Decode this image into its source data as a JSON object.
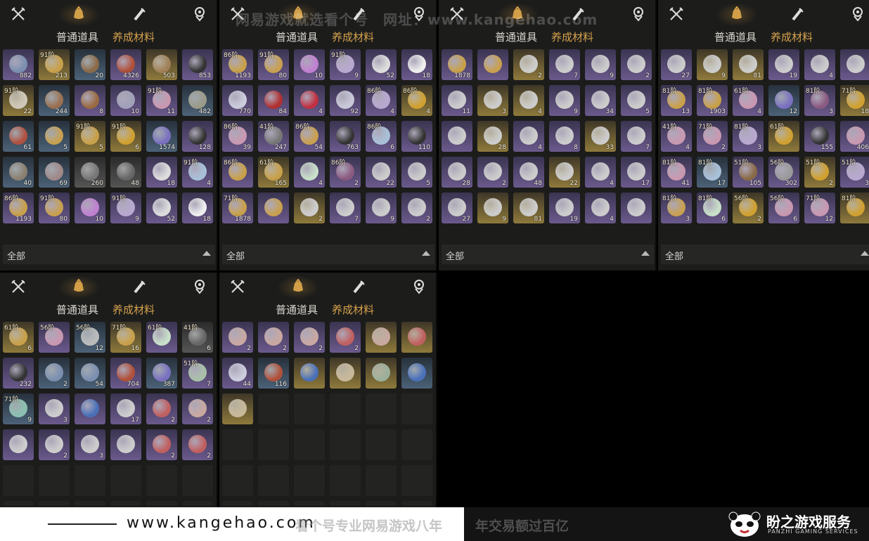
{
  "tabs": {
    "weapon_icon": "crossed-swords-icon",
    "bag_icon": "coin-bag-icon",
    "scroll_icon": "scroll-brush-icon",
    "gem_icon": "gem-badge-icon"
  },
  "subtabs": {
    "common": "普通道具",
    "growth": "养成材料"
  },
  "filter": {
    "label": "全部"
  },
  "colors": {
    "accent": "#d5a24c",
    "purple": "#6b5a8d",
    "gold": "#8f7a3c",
    "blue": "#4c6278"
  },
  "watermark_top": "网易游戏就选看个号　网址：www.kangehao.com",
  "banner": {
    "site": "www.kangehao.com",
    "slogan": "看个号专业网易游戏八年",
    "slogan2": "年交易额过百亿",
    "brand": "盼之游戏服务",
    "brand_sub": "PANZHI GAMING SERVICES"
  },
  "panels": [
    {
      "items": [
        {
          "q": "purple",
          "lvl": "",
          "qty": "882",
          "c": "#7b8fb0"
        },
        {
          "q": "gold",
          "lvl": "91阶",
          "qty": "213",
          "c": "#c8a04a"
        },
        {
          "q": "blue",
          "lvl": "",
          "qty": "20",
          "c": "#8a6a48"
        },
        {
          "q": "purple",
          "lvl": "",
          "qty": "4326",
          "c": "#b0503a"
        },
        {
          "q": "gold",
          "lvl": "",
          "qty": "503",
          "c": "#a08058"
        },
        {
          "q": "purple",
          "lvl": "",
          "qty": "853",
          "c": "#333"
        },
        {
          "q": "gold",
          "lvl": "91阶",
          "qty": "22",
          "c": "#cfc8b8"
        },
        {
          "q": "blue",
          "lvl": "",
          "qty": "244",
          "c": "#9a7050"
        },
        {
          "q": "purple",
          "lvl": "",
          "qty": "8",
          "c": "#9a6a40"
        },
        {
          "q": "purple",
          "lvl": "",
          "qty": "10",
          "c": "#a0a0b8"
        },
        {
          "q": "purple",
          "lvl": "91阶",
          "qty": "11",
          "c": "#c898b0"
        },
        {
          "q": "blue",
          "lvl": "",
          "qty": "482",
          "c": "#9a9a88"
        },
        {
          "q": "blue",
          "lvl": "",
          "qty": "61",
          "c": "#b05040"
        },
        {
          "q": "blue",
          "lvl": "",
          "qty": "5",
          "c": "#c8a050"
        },
        {
          "q": "gold",
          "lvl": "91阶",
          "qty": "5",
          "c": "#c8a04a"
        },
        {
          "q": "gold",
          "lvl": "91阶",
          "qty": "6",
          "c": "#d0a030"
        },
        {
          "q": "blue",
          "lvl": "",
          "qty": "1574",
          "c": "#7a70c0"
        },
        {
          "q": "purple",
          "lvl": "",
          "qty": "128",
          "c": "#333"
        },
        {
          "q": "blue",
          "lvl": "",
          "qty": "40",
          "c": "#8a8070"
        },
        {
          "q": "blue",
          "lvl": "",
          "qty": "69",
          "c": "#a08888"
        },
        {
          "q": "grey",
          "lvl": "",
          "qty": "260",
          "c": "#777"
        },
        {
          "q": "grey",
          "lvl": "",
          "qty": "48",
          "c": "#666"
        },
        {
          "q": "purple",
          "lvl": "",
          "qty": "18",
          "c": "#ddd"
        },
        {
          "q": "purple",
          "lvl": "91阶",
          "qty": "4",
          "c": "#a8c0d8"
        },
        {
          "q": "purple",
          "lvl": "86阶",
          "qty": "1193",
          "c": "#c8a04a"
        },
        {
          "q": "purple",
          "lvl": "91阶",
          "qty": "80",
          "c": "#c8a050"
        },
        {
          "q": "purple",
          "lvl": "",
          "qty": "10",
          "c": "#c080d0"
        },
        {
          "q": "purple",
          "lvl": "91阶",
          "qty": "9",
          "c": "#b8a8d0"
        },
        {
          "q": "purple",
          "lvl": "",
          "qty": "52",
          "c": "#ddd"
        },
        {
          "q": "purple",
          "lvl": "",
          "qty": "18",
          "c": "#eee"
        }
      ]
    },
    {
      "items": [
        {
          "q": "purple",
          "lvl": "86阶",
          "qty": "1193",
          "c": "#c8a04a"
        },
        {
          "q": "purple",
          "lvl": "91阶",
          "qty": "80",
          "c": "#c8a050"
        },
        {
          "q": "purple",
          "lvl": "",
          "qty": "10",
          "c": "#c080d0"
        },
        {
          "q": "purple",
          "lvl": "91阶",
          "qty": "9",
          "c": "#b8a8d0"
        },
        {
          "q": "purple",
          "lvl": "",
          "qty": "52",
          "c": "#ddd"
        },
        {
          "q": "purple",
          "lvl": "",
          "qty": "18",
          "c": "#eee"
        },
        {
          "q": "purple",
          "lvl": "",
          "qty": "770",
          "c": "#ccd"
        },
        {
          "q": "purple",
          "lvl": "",
          "qty": "84",
          "c": "#b03030"
        },
        {
          "q": "purple",
          "lvl": "",
          "qty": "4",
          "c": "#c03040"
        },
        {
          "q": "purple",
          "lvl": "",
          "qty": "92",
          "c": "#c8c8d8"
        },
        {
          "q": "purple",
          "lvl": "86阶",
          "qty": "4",
          "c": "#b8a8d0"
        },
        {
          "q": "gold",
          "lvl": "86阶",
          "qty": "4",
          "c": "#d0a030"
        },
        {
          "q": "purple",
          "lvl": "86阶",
          "qty": "39",
          "c": "#c898b0"
        },
        {
          "q": "purple",
          "lvl": "41阶",
          "qty": "247",
          "c": "#777"
        },
        {
          "q": "purple",
          "lvl": "86阶",
          "qty": "54",
          "c": "#c8a050"
        },
        {
          "q": "purple",
          "lvl": "",
          "qty": "763",
          "c": "#333"
        },
        {
          "q": "purple",
          "lvl": "86阶",
          "qty": "6",
          "c": "#a8c0d8"
        },
        {
          "q": "purple",
          "lvl": "",
          "qty": "110",
          "c": "#333"
        },
        {
          "q": "purple",
          "lvl": "86阶",
          "qty": "",
          "c": "#c8a04a"
        },
        {
          "q": "gold",
          "lvl": "61阶",
          "qty": "165",
          "c": "#c8a04a"
        },
        {
          "q": "purple",
          "lvl": "",
          "qty": "4",
          "c": "#c8e0c8"
        },
        {
          "q": "purple",
          "lvl": "86阶",
          "qty": "2",
          "c": "#8a5a80"
        },
        {
          "q": "purple",
          "lvl": "",
          "qty": "22",
          "c": "#ccc"
        },
        {
          "q": "purple",
          "lvl": "",
          "qty": "5",
          "c": "#ccc"
        },
        {
          "q": "purple",
          "lvl": "71阶",
          "qty": "1878",
          "c": "#c8a04a"
        },
        {
          "q": "purple",
          "lvl": "",
          "qty": "",
          "c": "#c8a050"
        },
        {
          "q": "gold",
          "lvl": "",
          "qty": "2",
          "c": "#ccc"
        },
        {
          "q": "purple",
          "lvl": "",
          "qty": "7",
          "c": "#ccc"
        },
        {
          "q": "purple",
          "lvl": "",
          "qty": "9",
          "c": "#ccc"
        },
        {
          "q": "purple",
          "lvl": "",
          "qty": "2",
          "c": "#ccc"
        }
      ]
    },
    {
      "items": [
        {
          "q": "purple",
          "lvl": "",
          "qty": "1878",
          "c": "#c8a04a"
        },
        {
          "q": "purple",
          "lvl": "",
          "qty": "",
          "c": "#c8a050"
        },
        {
          "q": "gold",
          "lvl": "",
          "qty": "2",
          "c": "#ccc"
        },
        {
          "q": "purple",
          "lvl": "",
          "qty": "7",
          "c": "#ccc"
        },
        {
          "q": "purple",
          "lvl": "",
          "qty": "9",
          "c": "#ccc"
        },
        {
          "q": "purple",
          "lvl": "",
          "qty": "2",
          "c": "#ccc"
        },
        {
          "q": "purple",
          "lvl": "",
          "qty": "11",
          "c": "#ccc"
        },
        {
          "q": "gold",
          "lvl": "",
          "qty": "3",
          "c": "#ccc"
        },
        {
          "q": "gold",
          "lvl": "",
          "qty": "4",
          "c": "#ccc"
        },
        {
          "q": "purple",
          "lvl": "",
          "qty": "9",
          "c": "#ccc"
        },
        {
          "q": "purple",
          "lvl": "",
          "qty": "34",
          "c": "#ccc"
        },
        {
          "q": "purple",
          "lvl": "",
          "qty": "5",
          "c": "#ccc"
        },
        {
          "q": "purple",
          "lvl": "",
          "qty": "",
          "c": "#ccc"
        },
        {
          "q": "gold",
          "lvl": "",
          "qty": "28",
          "c": "#ccc"
        },
        {
          "q": "purple",
          "lvl": "",
          "qty": "4",
          "c": "#ccc"
        },
        {
          "q": "purple",
          "lvl": "",
          "qty": "8",
          "c": "#ccc"
        },
        {
          "q": "gold",
          "lvl": "",
          "qty": "33",
          "c": "#ccc"
        },
        {
          "q": "purple",
          "lvl": "",
          "qty": "7",
          "c": "#ccc"
        },
        {
          "q": "purple",
          "lvl": "",
          "qty": "28",
          "c": "#ccc"
        },
        {
          "q": "purple",
          "lvl": "",
          "qty": "2",
          "c": "#ccc"
        },
        {
          "q": "purple",
          "lvl": "",
          "qty": "48",
          "c": "#ccc"
        },
        {
          "q": "gold",
          "lvl": "",
          "qty": "22",
          "c": "#ccc"
        },
        {
          "q": "purple",
          "lvl": "",
          "qty": "4",
          "c": "#ccc"
        },
        {
          "q": "purple",
          "lvl": "",
          "qty": "17",
          "c": "#ccc"
        },
        {
          "q": "purple",
          "lvl": "",
          "qty": "27",
          "c": "#ccc"
        },
        {
          "q": "gold",
          "lvl": "",
          "qty": "9",
          "c": "#ccc"
        },
        {
          "q": "gold",
          "lvl": "",
          "qty": "81",
          "c": "#ccc"
        },
        {
          "q": "purple",
          "lvl": "",
          "qty": "19",
          "c": "#ccc"
        },
        {
          "q": "purple",
          "lvl": "",
          "qty": "4",
          "c": "#ccc"
        },
        {
          "q": "purple",
          "lvl": "",
          "qty": "",
          "c": "#ccc"
        }
      ]
    },
    {
      "items": [
        {
          "q": "purple",
          "lvl": "",
          "qty": "27",
          "c": "#ccc"
        },
        {
          "q": "gold",
          "lvl": "",
          "qty": "9",
          "c": "#ccc"
        },
        {
          "q": "gold",
          "lvl": "",
          "qty": "81",
          "c": "#ccc"
        },
        {
          "q": "purple",
          "lvl": "",
          "qty": "19",
          "c": "#ccc"
        },
        {
          "q": "purple",
          "lvl": "",
          "qty": "4",
          "c": "#ccc"
        },
        {
          "q": "purple",
          "lvl": "",
          "qty": "",
          "c": "#ccc"
        },
        {
          "q": "purple",
          "lvl": "81阶",
          "qty": "13",
          "c": "#c8a04a"
        },
        {
          "q": "purple",
          "lvl": "81阶",
          "qty": "1903",
          "c": "#c8a04a"
        },
        {
          "q": "purple",
          "lvl": "61阶",
          "qty": "4",
          "c": "#c898b0"
        },
        {
          "q": "blue",
          "lvl": "",
          "qty": "12",
          "c": "#7a70c0"
        },
        {
          "q": "purple",
          "lvl": "81阶",
          "qty": "3",
          "c": "#8a5a80"
        },
        {
          "q": "gold",
          "lvl": "71阶",
          "qty": "18",
          "c": "#d0a030"
        },
        {
          "q": "purple",
          "lvl": "41阶",
          "qty": "4",
          "c": "#c898b0"
        },
        {
          "q": "purple",
          "lvl": "71阶",
          "qty": "2",
          "c": "#c898b0"
        },
        {
          "q": "purple",
          "lvl": "81阶",
          "qty": "3",
          "c": "#b8a8d0"
        },
        {
          "q": "gold",
          "lvl": "61阶",
          "qty": "",
          "c": "#d0a030"
        },
        {
          "q": "purple",
          "lvl": "",
          "qty": "155",
          "c": "#333"
        },
        {
          "q": "purple",
          "lvl": "",
          "qty": "406",
          "c": "#c898b0"
        },
        {
          "q": "purple",
          "lvl": "81阶",
          "qty": "41",
          "c": "#c898b0"
        },
        {
          "q": "blue",
          "lvl": "81阶",
          "qty": "17",
          "c": "#a8c0d8"
        },
        {
          "q": "purple",
          "lvl": "51阶",
          "qty": "105",
          "c": "#8a6a48"
        },
        {
          "q": "purple",
          "lvl": "56阶",
          "qty": "302",
          "c": "#999"
        },
        {
          "q": "gold",
          "lvl": "51阶",
          "qty": "2",
          "c": "#d0a030"
        },
        {
          "q": "purple",
          "lvl": "51阶",
          "qty": "3",
          "c": "#b8a8d0"
        },
        {
          "q": "purple",
          "lvl": "81阶",
          "qty": "3",
          "c": "#c8a050"
        },
        {
          "q": "purple",
          "lvl": "81阶",
          "qty": "6",
          "c": "#c8e0c8"
        },
        {
          "q": "gold",
          "lvl": "56阶",
          "qty": "2",
          "c": "#d0a030"
        },
        {
          "q": "purple",
          "lvl": "56阶",
          "qty": "6",
          "c": "#c898b0"
        },
        {
          "q": "purple",
          "lvl": "71阶",
          "qty": "12",
          "c": "#c898b0"
        },
        {
          "q": "gold",
          "lvl": "81阶",
          "qty": "",
          "c": "#d0a030"
        }
      ]
    },
    {
      "items": [
        {
          "q": "gold",
          "lvl": "61阶",
          "qty": "6",
          "c": "#c8a04a"
        },
        {
          "q": "purple",
          "lvl": "56阶",
          "qty": "",
          "c": "#c898b0"
        },
        {
          "q": "blue",
          "lvl": "56阶",
          "qty": "12",
          "c": "#bbb"
        },
        {
          "q": "gold",
          "lvl": "71阶",
          "qty": "16",
          "c": "#c8a04a"
        },
        {
          "q": "purple",
          "lvl": "61阶",
          "qty": "",
          "c": "#c8e0c8"
        },
        {
          "q": "grey",
          "lvl": "41阶",
          "qty": "6",
          "c": "#666"
        },
        {
          "q": "purple",
          "lvl": "",
          "qty": "232",
          "c": "#333"
        },
        {
          "q": "blue",
          "lvl": "",
          "qty": "2",
          "c": "#7b8fb0"
        },
        {
          "q": "blue",
          "lvl": "",
          "qty": "54",
          "c": "#7b8fb0"
        },
        {
          "q": "purple",
          "lvl": "",
          "qty": "704",
          "c": "#b0503a"
        },
        {
          "q": "blue",
          "lvl": "",
          "qty": "387",
          "c": "#7a70c0"
        },
        {
          "q": "purple",
          "lvl": "51阶",
          "qty": "7",
          "c": "#a8c0a8"
        },
        {
          "q": "blue",
          "lvl": "71阶",
          "qty": "9",
          "c": "#8ac0b0"
        },
        {
          "q": "purple",
          "lvl": "",
          "qty": "3",
          "c": "#ccc"
        },
        {
          "q": "purple",
          "lvl": "",
          "qty": "",
          "c": "#4a70b8"
        },
        {
          "q": "purple",
          "lvl": "",
          "qty": "17",
          "c": "#ccc"
        },
        {
          "q": "purple",
          "lvl": "",
          "qty": "2",
          "c": "#c06060"
        },
        {
          "q": "purple",
          "lvl": "",
          "qty": "2",
          "c": "#c8a8a0"
        },
        {
          "q": "purple",
          "lvl": "",
          "qty": "",
          "c": "#ccc"
        },
        {
          "q": "purple",
          "lvl": "",
          "qty": "2",
          "c": "#ccc"
        },
        {
          "q": "purple",
          "lvl": "",
          "qty": "3",
          "c": "#ccc"
        },
        {
          "q": "purple",
          "lvl": "",
          "qty": "",
          "c": "#ccc"
        },
        {
          "q": "purple",
          "lvl": "",
          "qty": "2",
          "c": "#c06060"
        },
        {
          "q": "purple",
          "lvl": "",
          "qty": "2",
          "c": "#c06060"
        }
      ]
    },
    {
      "items": [
        {
          "q": "purple",
          "lvl": "",
          "qty": "2",
          "c": "#c8a8a0"
        },
        {
          "q": "purple",
          "lvl": "",
          "qty": "2",
          "c": "#c8a8a0"
        },
        {
          "q": "purple",
          "lvl": "",
          "qty": "2",
          "c": "#c8a8a0"
        },
        {
          "q": "purple",
          "lvl": "",
          "qty": "2",
          "c": "#c06060"
        },
        {
          "q": "gold",
          "lvl": "",
          "qty": "",
          "c": "#c8a8a0"
        },
        {
          "q": "gold",
          "lvl": "",
          "qty": "",
          "c": "#c06060"
        },
        {
          "q": "purple",
          "lvl": "",
          "qty": "44",
          "c": "#ccd"
        },
        {
          "q": "blue",
          "lvl": "",
          "qty": "116",
          "c": "#b0503a"
        },
        {
          "q": "gold",
          "lvl": "",
          "qty": "",
          "c": "#4a70b8"
        },
        {
          "q": "gold",
          "lvl": "",
          "qty": "",
          "c": "#c8b89a"
        },
        {
          "q": "gold",
          "lvl": "",
          "qty": "",
          "c": "#9ab09a"
        },
        {
          "q": "blue",
          "lvl": "",
          "qty": "",
          "c": "#4a70b8"
        },
        {
          "q": "gold",
          "lvl": "",
          "qty": "",
          "c": "#c8b89a"
        }
      ]
    }
  ]
}
